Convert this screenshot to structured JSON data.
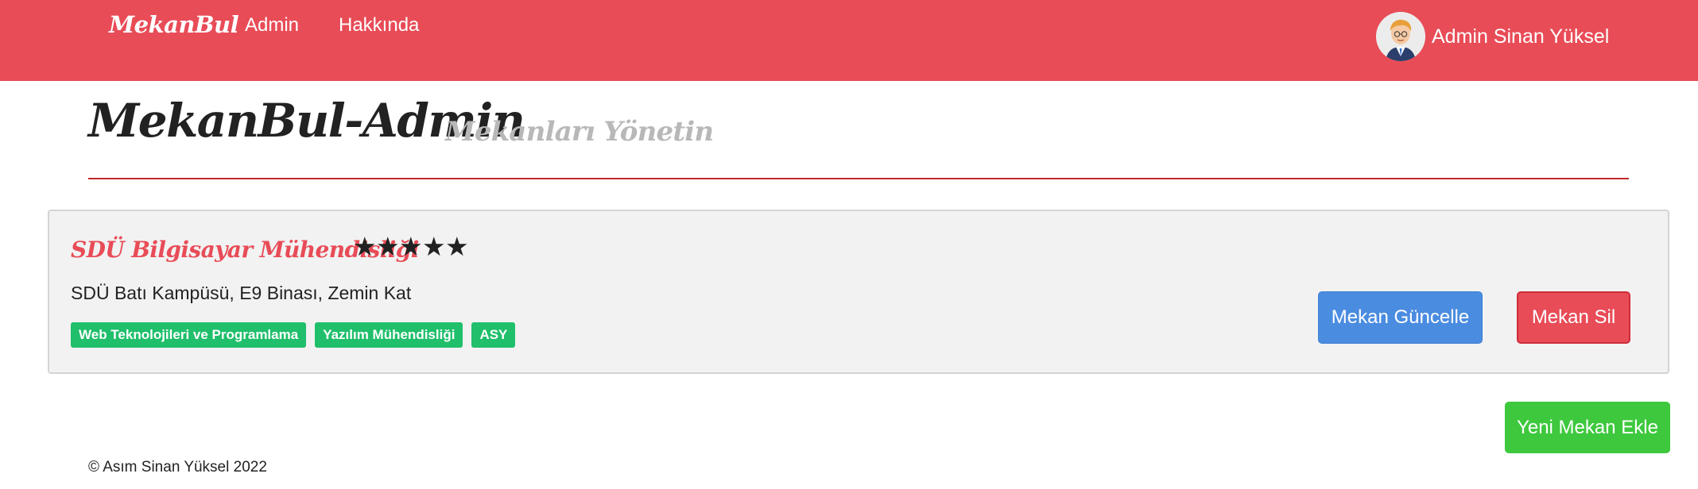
{
  "navbar": {
    "brand": "MekanBul",
    "links": [
      {
        "label": "Admin"
      },
      {
        "label": "Hakkında"
      }
    ],
    "user": {
      "name": "Admin Sinan Yüksel",
      "avatar_icon": "user-avatar"
    },
    "background_color": "#e84c57"
  },
  "header": {
    "title": "MekanBul-Admin",
    "subtitle": "Mekanları Yönetin"
  },
  "venues": [
    {
      "name": "SDÜ Bilgisayar Mühendisliği",
      "rating": 5,
      "rating_max": 5,
      "stars_text": "★★★★★",
      "address": "SDÜ Batı Kampüsü, E9 Binası, Zemin Kat",
      "tags": [
        "Web Teknolojileri ve Programlama",
        "Yazılım Mühendisliği",
        "ASY"
      ],
      "update_label": "Mekan Güncelle",
      "delete_label": "Mekan Sil"
    }
  ],
  "actions": {
    "add_label": "Yeni Mekan Ekle"
  },
  "footer": {
    "text": "© Asım Sinan Yüksel 2022"
  },
  "colors": {
    "accent": "#e84c57",
    "update_button": "#4a8ce0",
    "add_button": "#3ec83e",
    "tag": "#20bf6b"
  }
}
